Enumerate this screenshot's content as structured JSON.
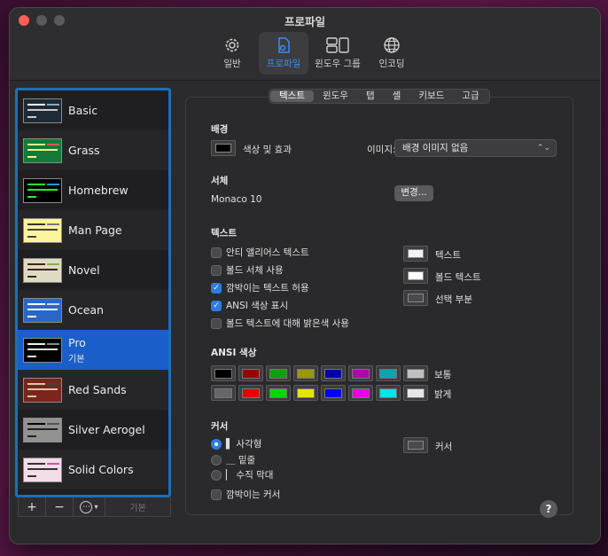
{
  "window": {
    "title": "프로파일"
  },
  "toolbar": {
    "items": [
      {
        "label": "일반",
        "icon": "gear-icon"
      },
      {
        "label": "프로파일",
        "icon": "profile-icon"
      },
      {
        "label": "윈도우 그룹",
        "icon": "window-group-icon"
      },
      {
        "label": "인코딩",
        "icon": "globe-icon"
      }
    ],
    "active": "프로파일"
  },
  "profiles": [
    {
      "name": "Basic"
    },
    {
      "name": "Grass"
    },
    {
      "name": "Homebrew"
    },
    {
      "name": "Man Page"
    },
    {
      "name": "Novel"
    },
    {
      "name": "Ocean"
    },
    {
      "name": "Pro",
      "sub": "기본",
      "selected": true
    },
    {
      "name": "Red Sands"
    },
    {
      "name": "Silver Aerogel"
    },
    {
      "name": "Solid Colors"
    }
  ],
  "sidebar_buttons": {
    "add": "+",
    "remove": "−",
    "more": "⋯",
    "default": "기본"
  },
  "tabs": [
    "텍스트",
    "윈도우",
    "탭",
    "셸",
    "키보드",
    "고급"
  ],
  "active_tab": "텍스트",
  "background": {
    "section": "배경",
    "color_effects": "색상 및 효과",
    "image_label": "이미지:",
    "image_value": "배경 이미지 없음"
  },
  "font": {
    "section": "서체",
    "value": "Monaco 10",
    "change_button": "변경..."
  },
  "text": {
    "section": "텍스트",
    "options": [
      {
        "label": "안티 앨리어스 텍스트",
        "checked": false
      },
      {
        "label": "볼드 서체 사용",
        "checked": false
      },
      {
        "label": "깜박이는 텍스트 허용",
        "checked": true
      },
      {
        "label": "ANSI 색상 표시",
        "checked": true
      },
      {
        "label": "볼드 텍스트에 대해 밝은색 사용",
        "checked": false
      }
    ],
    "colors": [
      {
        "label": "텍스트"
      },
      {
        "label": "볼드 텍스트"
      },
      {
        "label": "선택 부분"
      }
    ]
  },
  "ansi": {
    "section": "ANSI 색상",
    "normal_label": "보통",
    "bright_label": "밝게",
    "normal": [
      "#000000",
      "#990000",
      "#00a600",
      "#999900",
      "#0000b2",
      "#b200b2",
      "#00a6b2",
      "#bfbfbf"
    ],
    "bright": [
      "#666666",
      "#e50000",
      "#00d900",
      "#e5e500",
      "#0000ff",
      "#e500e5",
      "#00e5e5",
      "#e5e5e5"
    ]
  },
  "cursor": {
    "section": "커서",
    "options": [
      {
        "label": "▌ 사각형",
        "selected": true
      },
      {
        "label": "＿ 밑줄",
        "selected": false
      },
      {
        "label": "▏ 수직 막대",
        "selected": false
      }
    ],
    "blink_label": "깜박이는 커서",
    "blink_checked": false,
    "color_label": "커서"
  },
  "help": "?"
}
